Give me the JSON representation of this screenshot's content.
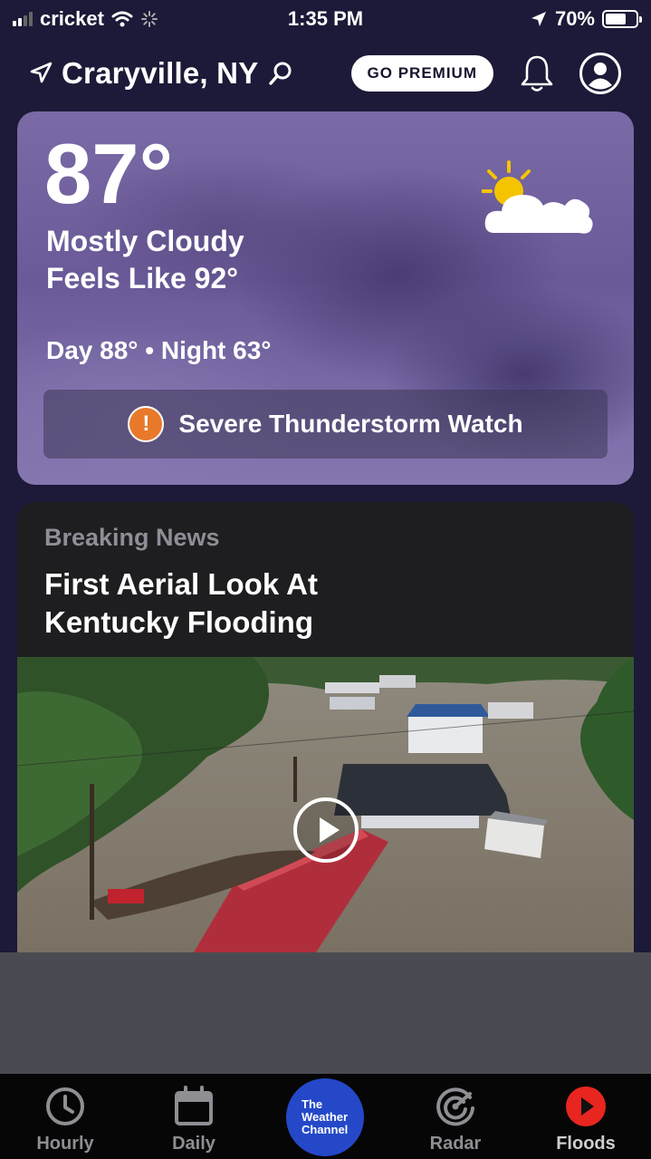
{
  "status_bar": {
    "carrier": "cricket",
    "time": "1:35 PM",
    "battery": "70%",
    "battery_level": 0.7
  },
  "header": {
    "location": "Craryville, NY",
    "premium_label": "GO PREMIUM",
    "icons": [
      "location-arrow-icon",
      "search-icon",
      "bell-icon",
      "profile-icon"
    ]
  },
  "current": {
    "temperature": "87°",
    "condition": "Mostly Cloudy",
    "feels_like": "Feels Like 92°",
    "day_night": "Day 88° • Night 63°",
    "alert_text": "Severe Thunderstorm Watch",
    "alert_icon": "!",
    "weather_icon": "partly-cloudy-icon"
  },
  "news": {
    "kicker": "Breaking News",
    "title_line1": "First Aerial Look At",
    "title_line2": "Kentucky Flooding"
  },
  "tabs": [
    {
      "label": "Hourly",
      "icon": "clock-icon"
    },
    {
      "label": "Daily",
      "icon": "calendar-icon"
    },
    {
      "label": "Radar",
      "icon": "radar-icon"
    },
    {
      "label": "Floods",
      "icon": "play-icon"
    }
  ],
  "logo": {
    "line1": "The",
    "line2": "Weather",
    "line3": "Channel"
  },
  "colors": {
    "background": "#1c1a38",
    "card_purple": "#7a6aa6",
    "alert_orange": "#e8792b",
    "logo_blue": "#2448c8",
    "floods_red": "#e8261f",
    "tab_bar": "#060606"
  }
}
